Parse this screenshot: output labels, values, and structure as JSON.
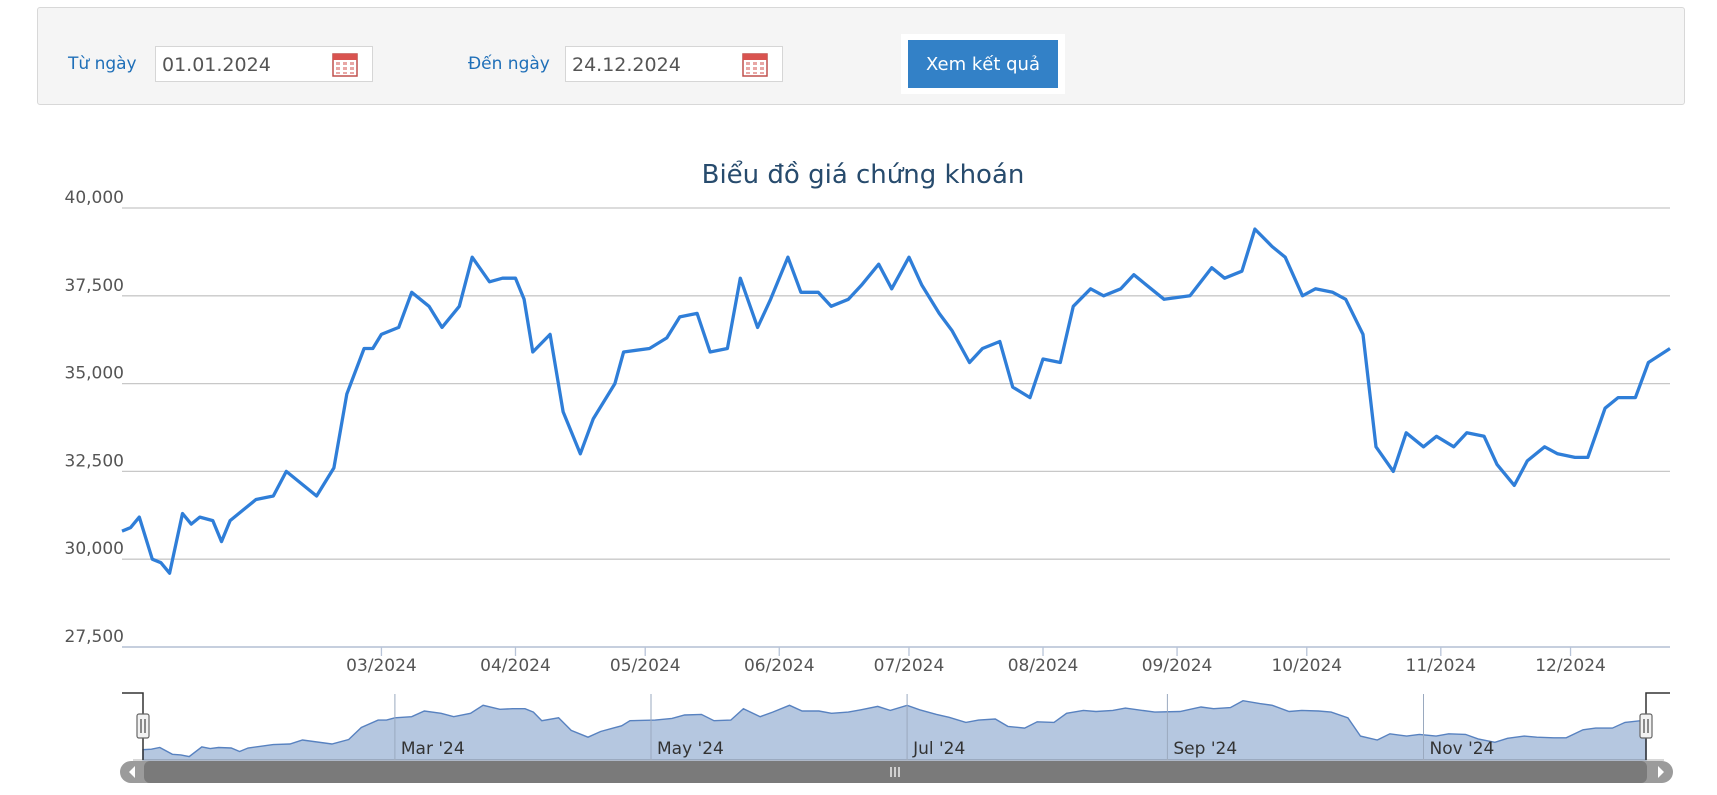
{
  "filter": {
    "from_label": "Từ ngày",
    "from_value": "01.01.2024",
    "to_label": "Đến ngày",
    "to_value": "24.12.2024",
    "submit_label": "Xem kết quả"
  },
  "chart_data": {
    "type": "line",
    "title": "Biểu đồ giá chứng khoán",
    "xlabel": "",
    "ylabel": "",
    "ylim": [
      27500,
      40000
    ],
    "yticks": [
      27500,
      30000,
      32500,
      35000,
      37500,
      40000
    ],
    "ytick_labels": [
      "27,500",
      "30,000",
      "32,500",
      "35,000",
      "37,500",
      "40,000"
    ],
    "xlim": [
      "2024-01-01",
      "2024-12-24"
    ],
    "xticks": [
      {
        "date": "2024-03-01",
        "label": "03/2024"
      },
      {
        "date": "2024-04-01",
        "label": "04/2024"
      },
      {
        "date": "2024-05-01",
        "label": "05/2024"
      },
      {
        "date": "2024-06-01",
        "label": "06/2024"
      },
      {
        "date": "2024-07-01",
        "label": "07/2024"
      },
      {
        "date": "2024-08-01",
        "label": "08/2024"
      },
      {
        "date": "2024-09-01",
        "label": "09/2024"
      },
      {
        "date": "2024-10-01",
        "label": "10/2024"
      },
      {
        "date": "2024-11-01",
        "label": "11/2024"
      },
      {
        "date": "2024-12-01",
        "label": "12/2024"
      }
    ],
    "navigator_labels": [
      {
        "date": "2024-03-01",
        "label": "Mar '24"
      },
      {
        "date": "2024-05-01",
        "label": "May '24"
      },
      {
        "date": "2024-07-01",
        "label": "Jul '24"
      },
      {
        "date": "2024-09-01",
        "label": "Sep '24"
      },
      {
        "date": "2024-11-01",
        "label": "Nov '24"
      }
    ],
    "grid": true,
    "color": "#2f7ed8",
    "series": [
      {
        "x": [
          "2024-01-01",
          "2024-01-03",
          "2024-01-05",
          "2024-01-08",
          "2024-01-10",
          "2024-01-12",
          "2024-01-15",
          "2024-01-17",
          "2024-01-19",
          "2024-01-22",
          "2024-01-24",
          "2024-01-26",
          "2024-01-29",
          "2024-02-01",
          "2024-02-05",
          "2024-02-08",
          "2024-02-15",
          "2024-02-19",
          "2024-02-22",
          "2024-02-26",
          "2024-02-28",
          "2024-03-01",
          "2024-03-05",
          "2024-03-08",
          "2024-03-12",
          "2024-03-15",
          "2024-03-19",
          "2024-03-22",
          "2024-03-26",
          "2024-03-29",
          "2024-04-01",
          "2024-04-03",
          "2024-04-05",
          "2024-04-09",
          "2024-04-12",
          "2024-04-16",
          "2024-04-19",
          "2024-04-22",
          "2024-04-24",
          "2024-04-26",
          "2024-05-02",
          "2024-05-06",
          "2024-05-09",
          "2024-05-13",
          "2024-05-16",
          "2024-05-20",
          "2024-05-23",
          "2024-05-27",
          "2024-05-30",
          "2024-06-03",
          "2024-06-06",
          "2024-06-10",
          "2024-06-13",
          "2024-06-17",
          "2024-06-20",
          "2024-06-24",
          "2024-06-27",
          "2024-07-01",
          "2024-07-04",
          "2024-07-08",
          "2024-07-11",
          "2024-07-15",
          "2024-07-18",
          "2024-07-22",
          "2024-07-25",
          "2024-07-29",
          "2024-08-01",
          "2024-08-05",
          "2024-08-08",
          "2024-08-12",
          "2024-08-15",
          "2024-08-19",
          "2024-08-22",
          "2024-08-26",
          "2024-08-29",
          "2024-09-04",
          "2024-09-09",
          "2024-09-12",
          "2024-09-16",
          "2024-09-19",
          "2024-09-23",
          "2024-09-26",
          "2024-09-30",
          "2024-10-03",
          "2024-10-07",
          "2024-10-10",
          "2024-10-14",
          "2024-10-17",
          "2024-10-21",
          "2024-10-24",
          "2024-10-28",
          "2024-10-31",
          "2024-11-04",
          "2024-11-07",
          "2024-11-11",
          "2024-11-14",
          "2024-11-18",
          "2024-11-21",
          "2024-11-25",
          "2024-11-28",
          "2024-12-02",
          "2024-12-05",
          "2024-12-09",
          "2024-12-12",
          "2024-12-16",
          "2024-12-19",
          "2024-12-24"
        ],
        "y": [
          30800,
          30900,
          31200,
          30000,
          29900,
          29600,
          31300,
          31000,
          31200,
          31100,
          30500,
          31100,
          31400,
          31700,
          31800,
          32500,
          31800,
          32600,
          34700,
          36000,
          36000,
          36400,
          36600,
          37600,
          37200,
          36600,
          37200,
          38600,
          37900,
          38000,
          38000,
          37400,
          35900,
          36400,
          34200,
          33000,
          34000,
          34600,
          35000,
          35900,
          36000,
          36300,
          36900,
          37000,
          35900,
          36000,
          38000,
          36600,
          37400,
          38600,
          37600,
          37600,
          37200,
          37400,
          37800,
          38400,
          37700,
          38600,
          37800,
          37000,
          36500,
          35600,
          36000,
          36200,
          34900,
          34600,
          35700,
          35600,
          37200,
          37700,
          37500,
          37700,
          38100,
          37700,
          37400,
          37500,
          38300,
          38000,
          38200,
          39400,
          38900,
          38600,
          37500,
          37700,
          37600,
          37400,
          36400,
          33200,
          32500,
          33600,
          33200,
          33500,
          33200,
          33600,
          33500,
          32700,
          32100,
          32800,
          33200,
          33000,
          32900,
          32900,
          34300,
          34600,
          34600,
          35600,
          36000
        ]
      }
    ]
  }
}
